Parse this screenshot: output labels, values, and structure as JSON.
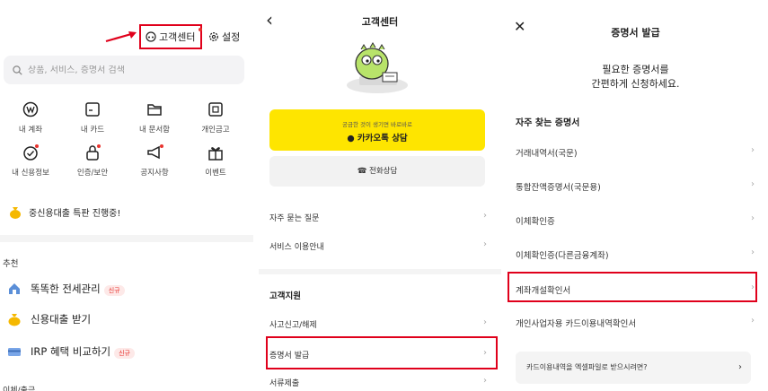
{
  "panel1": {
    "customer_center": "고객센터",
    "settings": "설정",
    "search_placeholder": "상품, 서비스, 증명서 검색",
    "grid": [
      {
        "label": "내 계좌",
        "icon": "won-coin-icon"
      },
      {
        "label": "내 카드",
        "icon": "card-icon"
      },
      {
        "label": "내 문서함",
        "icon": "folder-icon"
      },
      {
        "label": "개인금고",
        "icon": "safe-icon"
      },
      {
        "label": "내 신용정보",
        "icon": "credit-check-icon"
      },
      {
        "label": "인증/보안",
        "icon": "lock-icon"
      },
      {
        "label": "공지사항",
        "icon": "megaphone-icon"
      },
      {
        "label": "이벤트",
        "icon": "gift-icon"
      }
    ],
    "promo": "중신용대출 특판 진행중!",
    "recommend_label": "추천",
    "recommend": [
      {
        "label": "똑똑한 전세관리",
        "badge": "신규",
        "icon": "house-icon"
      },
      {
        "label": "신용대출 받기",
        "badge": "",
        "icon": "money-bag-icon"
      },
      {
        "label": "IRP 혜택 비교하기",
        "badge": "신규",
        "icon": "card-stack-icon"
      }
    ],
    "cut_text": "이체/출금"
  },
  "panel2": {
    "title": "고객센터",
    "kakao_sub": "궁금한 것이 생기면 바로바로",
    "kakao_main": "카카오톡 상담",
    "phone": "전화상담",
    "rows_top": [
      "자주 묻는 질문",
      "서비스 이용안내"
    ],
    "support_title": "고객지원",
    "rows_bottom": [
      "사고신고/해제",
      "증명서 발급",
      "서류제출"
    ]
  },
  "panel3": {
    "title": "증명서 발급",
    "intro_line1": "필요한 증명서를",
    "intro_line2": "간편하게 신청하세요.",
    "section": "자주 찾는 증명서",
    "rows": [
      "거래내역서(국문)",
      "통합잔액증명서(국문용)",
      "이체확인증",
      "이체확인증(다른금융계좌)",
      "계좌개설확인서",
      "개인사업자용 카드이용내역확인서"
    ],
    "card_box": "카드이용내역을 엑셀파일로 받으시려면?"
  },
  "colors": {
    "highlight": "#e0001b",
    "kakao": "#fee500"
  }
}
